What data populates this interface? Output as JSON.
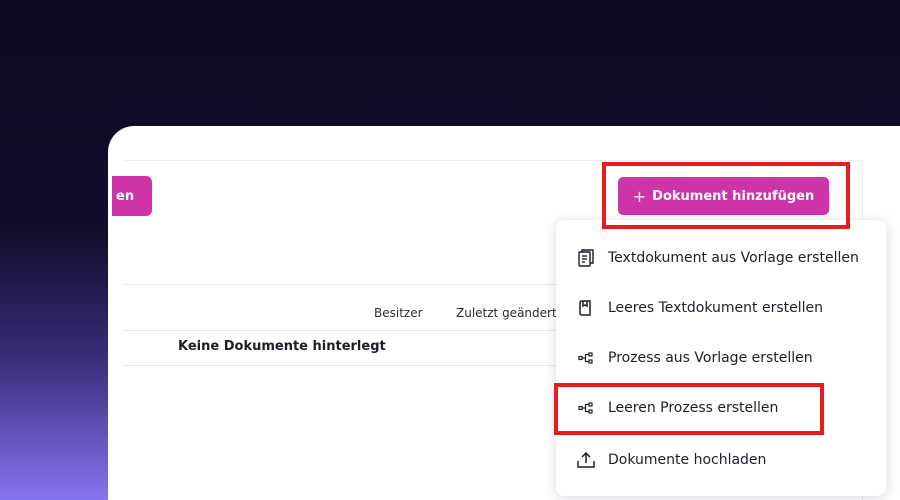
{
  "toolbar": {
    "left_button_label": "en",
    "add_document_icon": "plus-icon",
    "add_document_label": "Dokument hinzufügen"
  },
  "table": {
    "columns": [
      "Besitzer",
      "Zuletzt geändert"
    ],
    "empty_message": "Keine Dokumente hinterlegt"
  },
  "menu": {
    "items": [
      {
        "label": "Textdokument aus Vorlage erstellen",
        "icon": "document-template-icon"
      },
      {
        "label": "Leeres Textdokument erstellen",
        "icon": "blank-document-icon"
      },
      {
        "label": "Prozess aus Vorlage erstellen",
        "icon": "process-icon"
      },
      {
        "label": "Leeren Prozess erstellen",
        "icon": "process-icon"
      },
      {
        "label": "Dokumente hochladen",
        "icon": "upload-icon"
      }
    ]
  },
  "colors": {
    "accent": "#cc34a8",
    "highlight": "#e41e1e",
    "background_dark": "#0f0a24",
    "background_light": "#8674f0"
  }
}
